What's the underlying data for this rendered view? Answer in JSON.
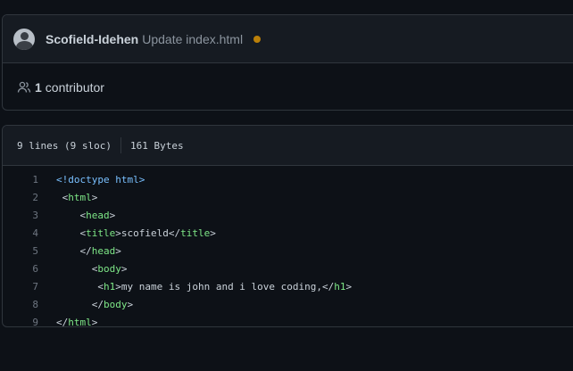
{
  "commit": {
    "author": "Scofield-Idehen",
    "message": "Update index.html",
    "status_color": "#bb8009"
  },
  "contributors": {
    "count": "1",
    "label": "contributor",
    "icon": "people-icon"
  },
  "file": {
    "lines": "9 lines (9 sloc)",
    "size": "161 Bytes",
    "code": [
      {
        "n": "1",
        "indent": "",
        "parts": [
          {
            "t": "<!doctype html>",
            "c": "doctype"
          }
        ]
      },
      {
        "n": "2",
        "indent": " ",
        "parts": [
          {
            "t": "<",
            "c": "punct"
          },
          {
            "t": "html",
            "c": "tag"
          },
          {
            "t": ">",
            "c": "punct"
          }
        ]
      },
      {
        "n": "3",
        "indent": "    ",
        "parts": [
          {
            "t": "<",
            "c": "punct"
          },
          {
            "t": "head",
            "c": "tag"
          },
          {
            "t": ">",
            "c": "punct"
          }
        ]
      },
      {
        "n": "4",
        "indent": "    ",
        "parts": [
          {
            "t": "<",
            "c": "punct"
          },
          {
            "t": "title",
            "c": "tag"
          },
          {
            "t": ">scofield</",
            "c": "punct"
          },
          {
            "t": "title",
            "c": "tag"
          },
          {
            "t": ">",
            "c": "punct"
          }
        ]
      },
      {
        "n": "5",
        "indent": "    ",
        "parts": [
          {
            "t": "</",
            "c": "punct"
          },
          {
            "t": "head",
            "c": "tag"
          },
          {
            "t": ">",
            "c": "punct"
          }
        ]
      },
      {
        "n": "6",
        "indent": "      ",
        "parts": [
          {
            "t": "<",
            "c": "punct"
          },
          {
            "t": "body",
            "c": "tag"
          },
          {
            "t": ">",
            "c": "punct"
          }
        ]
      },
      {
        "n": "7",
        "indent": "       ",
        "parts": [
          {
            "t": "<",
            "c": "punct"
          },
          {
            "t": "h1",
            "c": "tag"
          },
          {
            "t": ">my name is john and i love coding,</",
            "c": "punct"
          },
          {
            "t": "h1",
            "c": "tag"
          },
          {
            "t": ">",
            "c": "punct"
          }
        ]
      },
      {
        "n": "8",
        "indent": "      ",
        "parts": [
          {
            "t": "</",
            "c": "punct"
          },
          {
            "t": "body",
            "c": "tag"
          },
          {
            "t": ">",
            "c": "punct"
          }
        ]
      },
      {
        "n": "9",
        "indent": "",
        "parts": [
          {
            "t": "</",
            "c": "punct"
          },
          {
            "t": "html",
            "c": "tag"
          },
          {
            "t": ">",
            "c": "punct"
          }
        ]
      }
    ]
  }
}
